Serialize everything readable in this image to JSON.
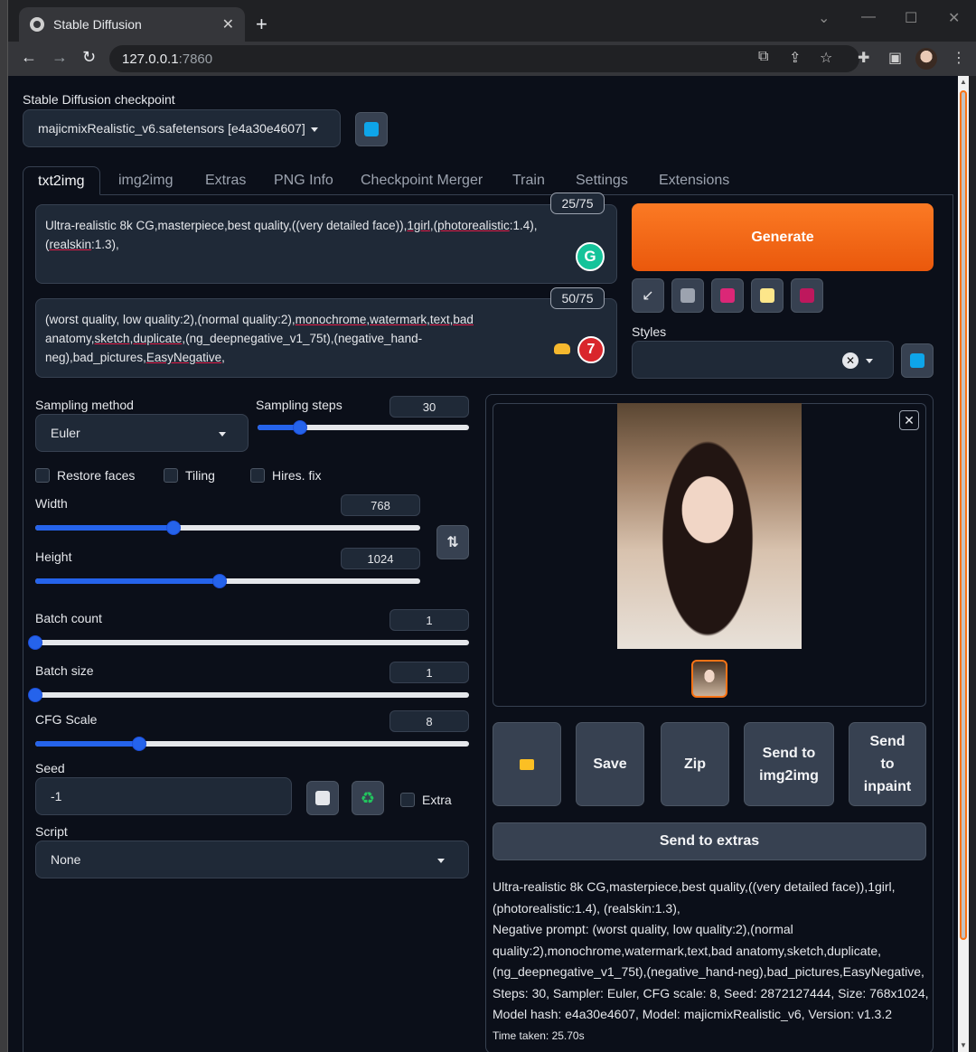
{
  "browser": {
    "tab_title": "Stable Diffusion",
    "url_host": "127.0.0.1",
    "url_port": ":7860"
  },
  "checkpoint": {
    "label": "Stable Diffusion checkpoint",
    "value": "majicmixRealistic_v6.safetensors [e4a30e4607]"
  },
  "tabs": [
    "txt2img",
    "img2img",
    "Extras",
    "PNG Info",
    "Checkpoint Merger",
    "Train",
    "Settings",
    "Extensions"
  ],
  "prompt": {
    "counter": "25/75",
    "line1_a": "Ultra-realistic 8k CG,masterpiece,best quality,((very detailed face)),",
    "line1_b": "1girl",
    "line1_c": ",(",
    "line1_d": "photorealistic",
    "line1_e": ":1.4),",
    "line2_a": "(",
    "line2_b": "realskin",
    "line2_c": ":1.3),"
  },
  "negative": {
    "counter": "50/75",
    "l1_a": "(worst quality, low quality:2),(normal quality:2),",
    "l1_b": "monochrome,watermark,text,bad",
    "l2_a": "anatomy,",
    "l2_b": "sketch",
    "l2_c": ",",
    "l2_d": "duplicate",
    "l2_e": ",(ng_deepnegative_v1_75t),(negative_hand-",
    "l3_a": "neg),bad_pictures,",
    "l3_b": "EasyNegative",
    "l3_c": ","
  },
  "generate_label": "Generate",
  "styles_label": "Styles",
  "sampling": {
    "method_label": "Sampling method",
    "method_value": "Euler",
    "steps_label": "Sampling steps",
    "steps_value": "30",
    "steps_fraction": 0.2
  },
  "checkboxes": {
    "restore_faces": "Restore faces",
    "tiling": "Tiling",
    "hires_fix": "Hires. fix"
  },
  "width": {
    "label": "Width",
    "value": "768",
    "fraction": 0.36
  },
  "height": {
    "label": "Height",
    "value": "1024",
    "fraction": 0.48
  },
  "batch_count": {
    "label": "Batch count",
    "value": "1",
    "fraction": 0.0
  },
  "batch_size": {
    "label": "Batch size",
    "value": "1",
    "fraction": 0.0
  },
  "cfg_scale": {
    "label": "CFG Scale",
    "value": "8",
    "fraction": 0.24
  },
  "seed": {
    "label": "Seed",
    "value": "-1",
    "extra_label": "Extra"
  },
  "script": {
    "label": "Script",
    "value": "None"
  },
  "actions": {
    "save": "Save",
    "zip": "Zip",
    "send_img2img_1": "Send to",
    "send_img2img_2": "img2img",
    "send_inpaint_1": "Send",
    "send_inpaint_2": "to",
    "send_inpaint_3": "inpaint",
    "send_extras": "Send to extras"
  },
  "info": {
    "line1": "Ultra-realistic 8k CG,masterpiece,best quality,((very detailed face)),1girl,",
    "line2": "(photorealistic:1.4), (realskin:1.3),",
    "line3": "Negative prompt: (worst quality, low quality:2),(normal",
    "line4": "quality:2),monochrome,watermark,text,bad anatomy,sketch,duplicate,",
    "line5": "(ng_deepnegative_v1_75t),(negative_hand-neg),bad_pictures,EasyNegative,",
    "line6": "Steps: 30, Sampler: Euler, CFG scale: 8, Seed: 2872127444, Size: 768x1024,",
    "line7": "Model hash: e4a30e4607, Model: majicmixRealistic_v6, Version: v1.3.2",
    "line8": "Time taken: 25.70s"
  },
  "colors": {
    "accent_orange": "#f97316",
    "slider_blue": "#2563eb",
    "page_bg": "#0b0f19"
  }
}
